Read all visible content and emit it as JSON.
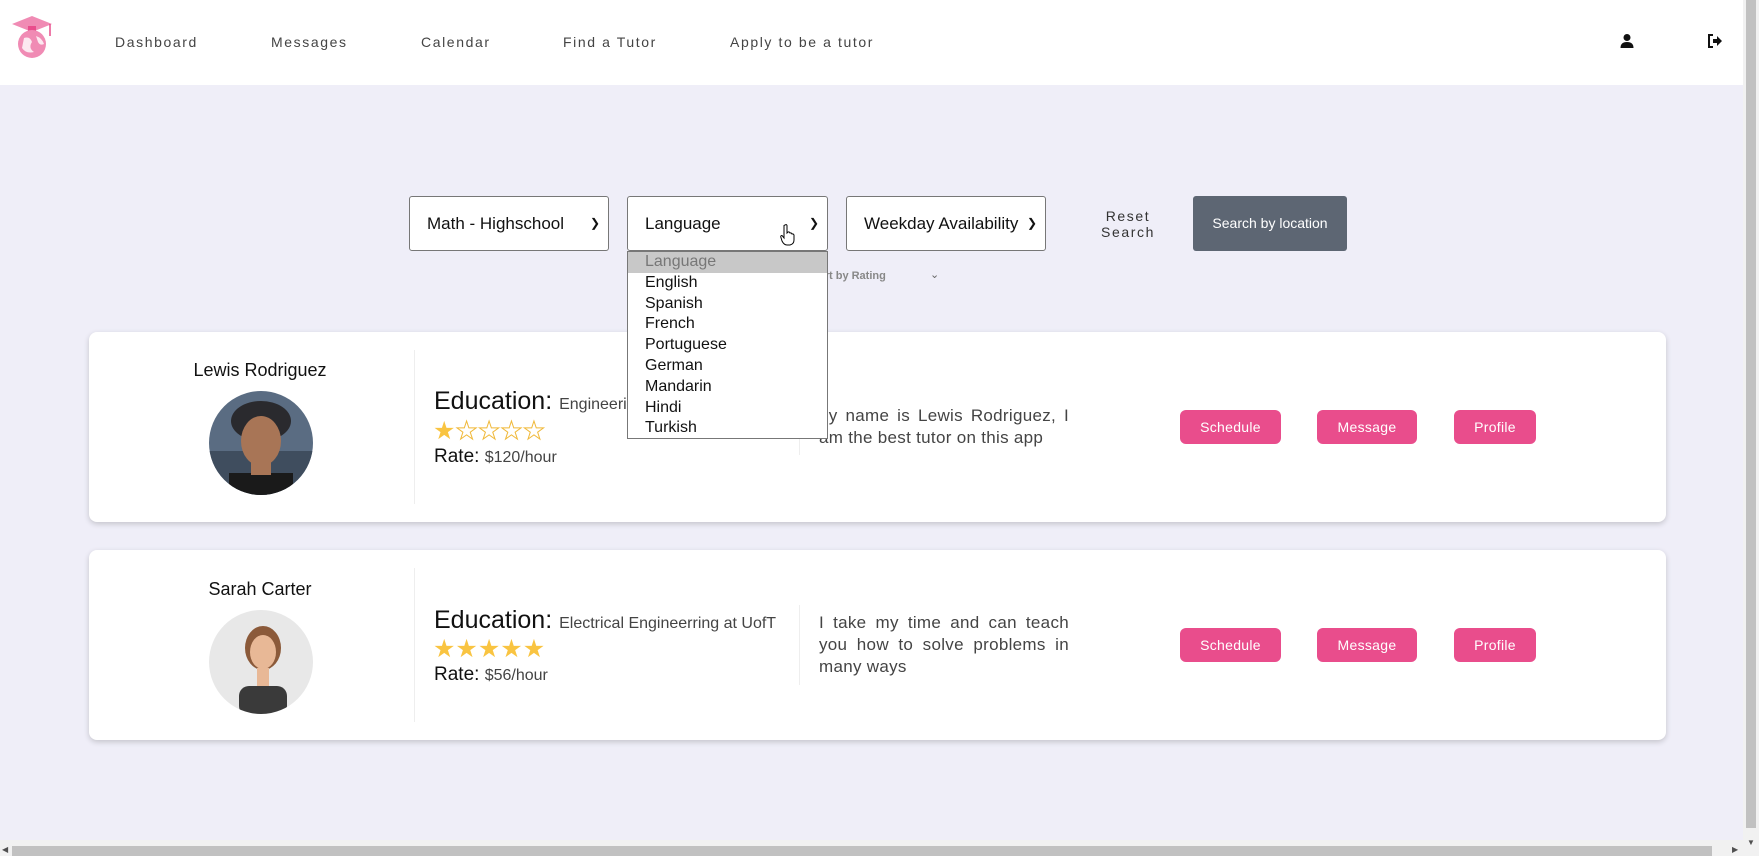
{
  "nav": {
    "links": [
      "Dashboard",
      "Messages",
      "Calendar",
      "Find a Tutor",
      "Apply to be a tutor"
    ],
    "profile_icon": "user-icon",
    "logout_icon": "sign-out-icon",
    "logo_icon": "graduation-globe-logo",
    "brand_color": "#e94d8c"
  },
  "filters": {
    "subject": "Math - Highschool",
    "language": "Language",
    "availability": "Weekday Availability",
    "reset_line1": "Reset",
    "reset_line2": "Search",
    "location_button": "Search by location",
    "sort_label": "ort by Rating"
  },
  "language_dropdown": {
    "options": [
      "Language",
      "English",
      "Spanish",
      "French",
      "Portuguese",
      "German",
      "Mandarin",
      "Hindi",
      "Turkish"
    ],
    "selected": "Language"
  },
  "tutors": [
    {
      "name": "Lewis Rodriguez",
      "education_label": "Education:",
      "education": "Engineering",
      "rating": 1,
      "rating_max": 5,
      "rate_label": "Rate:",
      "rate": "$120/hour",
      "bio": "ny name is Lewis Rodriguez, I am the best tutor on this app",
      "schedule": "Schedule",
      "message": "Message",
      "profile": "Profile"
    },
    {
      "name": "Sarah Carter",
      "education_label": "Education:",
      "education": "Electrical Engineerring at UofT",
      "rating": 5,
      "rating_max": 5,
      "rate_label": "Rate:",
      "rate": "$56/hour",
      "bio": "I take my time and can teach you how to solve problems in many ways",
      "schedule": "Schedule",
      "message": "Message",
      "profile": "Profile"
    }
  ]
}
